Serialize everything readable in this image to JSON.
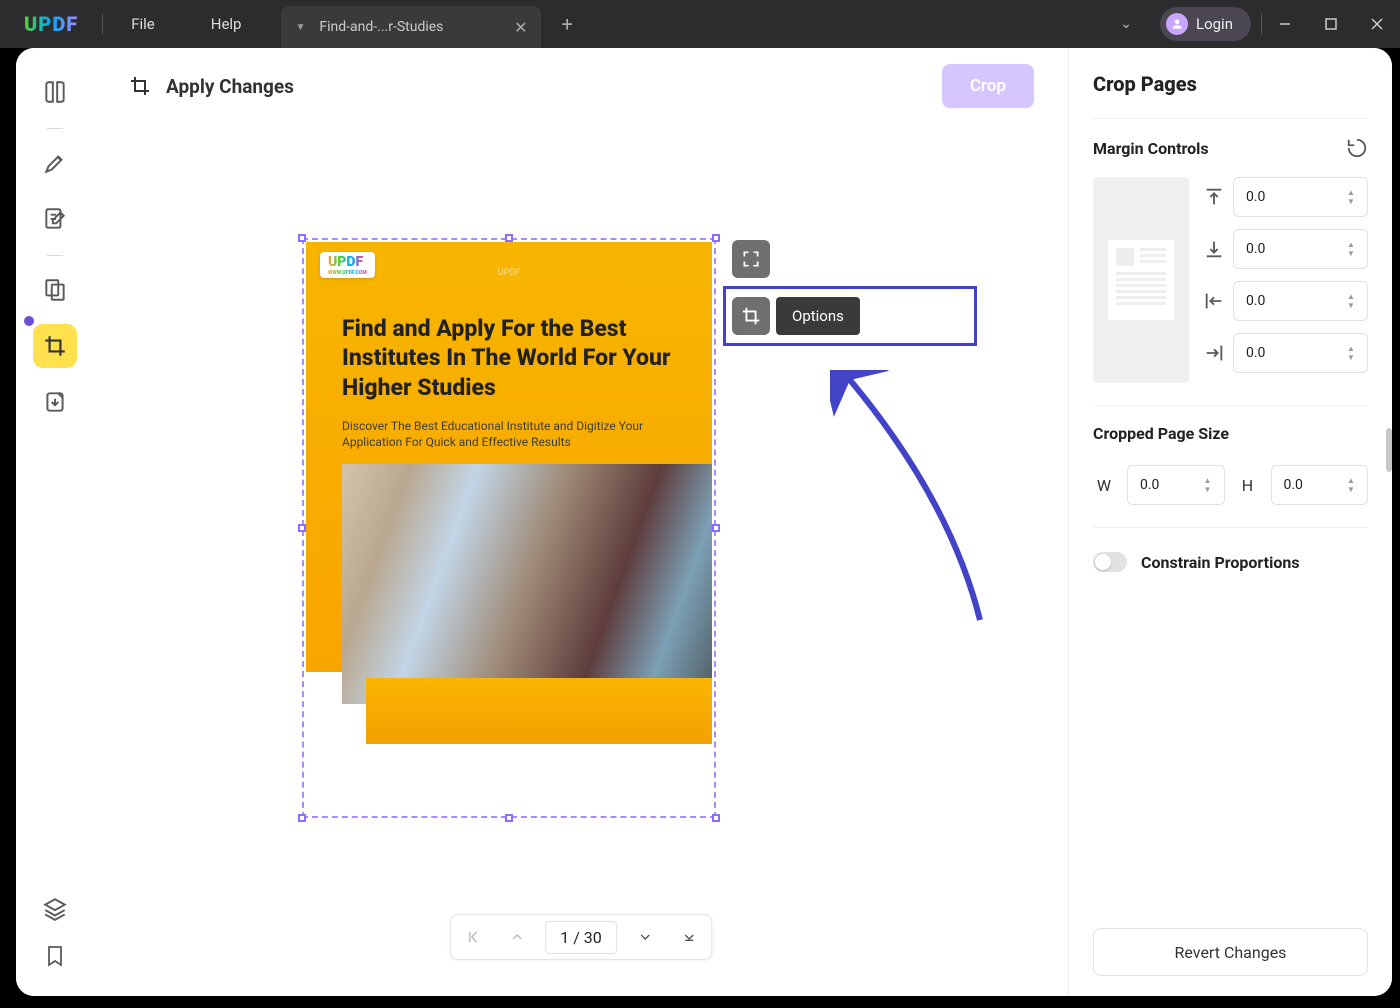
{
  "titlebar": {
    "logo": "UPDF",
    "menu": {
      "file": "File",
      "help": "Help"
    },
    "tab": {
      "title": "Find-and-...r-Studies"
    },
    "login": "Login"
  },
  "main_header": {
    "apply": "Apply Changes",
    "crop": "Crop"
  },
  "floating": {
    "options": "Options"
  },
  "document": {
    "brand": "UPDF",
    "brand_sub": "WWW.UPDF.COM",
    "brand_center": "UPDF",
    "title": "Find and Apply For the Best Institutes In The World For Your Higher Studies",
    "subtitle": "Discover The Best Educational Institute and Digitize Your Application For Quick and Effective Results"
  },
  "pager": {
    "current": "1",
    "sep": " / ",
    "total": "30"
  },
  "right_panel": {
    "title": "Crop Pages",
    "margin_controls": "Margin Controls",
    "margins": {
      "top": "0.0",
      "bottom": "0.0",
      "left": "0.0",
      "right": "0.0"
    },
    "cropped_size": "Cropped Page Size",
    "w_label": "W",
    "h_label": "H",
    "size": {
      "w": "0.0",
      "h": "0.0"
    },
    "constrain": "Constrain Proportions",
    "revert": "Revert Changes"
  }
}
